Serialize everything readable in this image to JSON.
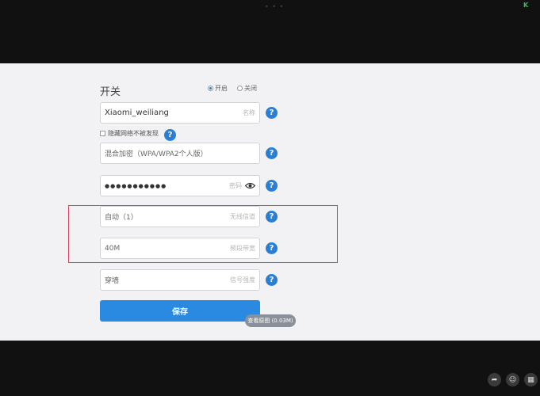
{
  "switch": {
    "label": "开关",
    "on_label": "开启",
    "off_label": "关闭",
    "selected": "on"
  },
  "ssid": {
    "value": "Xiaomi_weiliang",
    "placeholder": "名称"
  },
  "hide_network": {
    "label": "隐藏网络不被发现",
    "checked": false
  },
  "encryption": {
    "value": "混合加密（WPA/WPA2个人版）"
  },
  "password": {
    "value": "●●●●●●●●●●●",
    "placeholder": "密码"
  },
  "channel": {
    "value": "自动（1）",
    "placeholder": "无线信道"
  },
  "bandwidth": {
    "value": "40M",
    "placeholder": "频段带宽"
  },
  "signal": {
    "value": "穿墙",
    "placeholder": "信号强度"
  },
  "save_label": "保存",
  "view_original": "查看原图 (0.03M)",
  "colors": {
    "accent": "#2a8ae2",
    "highlight": "#d9435f",
    "panel": "#f2f2f4"
  },
  "icons": [
    "help-icon",
    "eye-icon",
    "share-icon",
    "emoji-icon",
    "grid-icon"
  ]
}
